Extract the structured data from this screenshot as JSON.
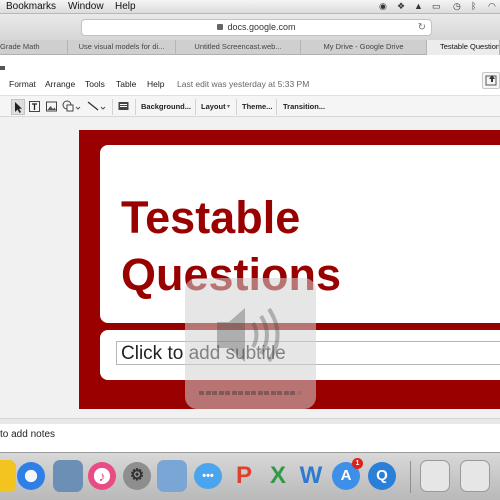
{
  "menubar": {
    "items": [
      "Bookmarks",
      "Window",
      "Help"
    ],
    "tray_icons": [
      "record-icon",
      "dropbox-icon",
      "drive-icon",
      "airplay-icon",
      "time-machine-icon",
      "bluetooth-icon",
      "wifi-icon"
    ]
  },
  "browser": {
    "url": "docs.google.com",
    "tabs": [
      "Grade Math",
      "Use visual models for di...",
      "Untitled Screencast.web...",
      "My Drive - Google Drive",
      "Testable Questions"
    ],
    "active_tab": "Testable Questions"
  },
  "app": {
    "menus": [
      "Format",
      "Arrange",
      "Tools",
      "Table",
      "Help"
    ],
    "last_edit": "Last edit was yesterday at 5:33 PM"
  },
  "toolbar": {
    "background": "Background...",
    "layout": "Layout",
    "theme": "Theme...",
    "transition": "Transition..."
  },
  "slide": {
    "title_line1": "Testable",
    "title_line2": "Questions",
    "subtitle_placeholder": "Click to add subtitle",
    "accent": "#990000"
  },
  "notes": {
    "placeholder": "to add notes"
  },
  "volume": {
    "level": 0.94
  },
  "dock": {
    "app_store_badge": "1"
  }
}
